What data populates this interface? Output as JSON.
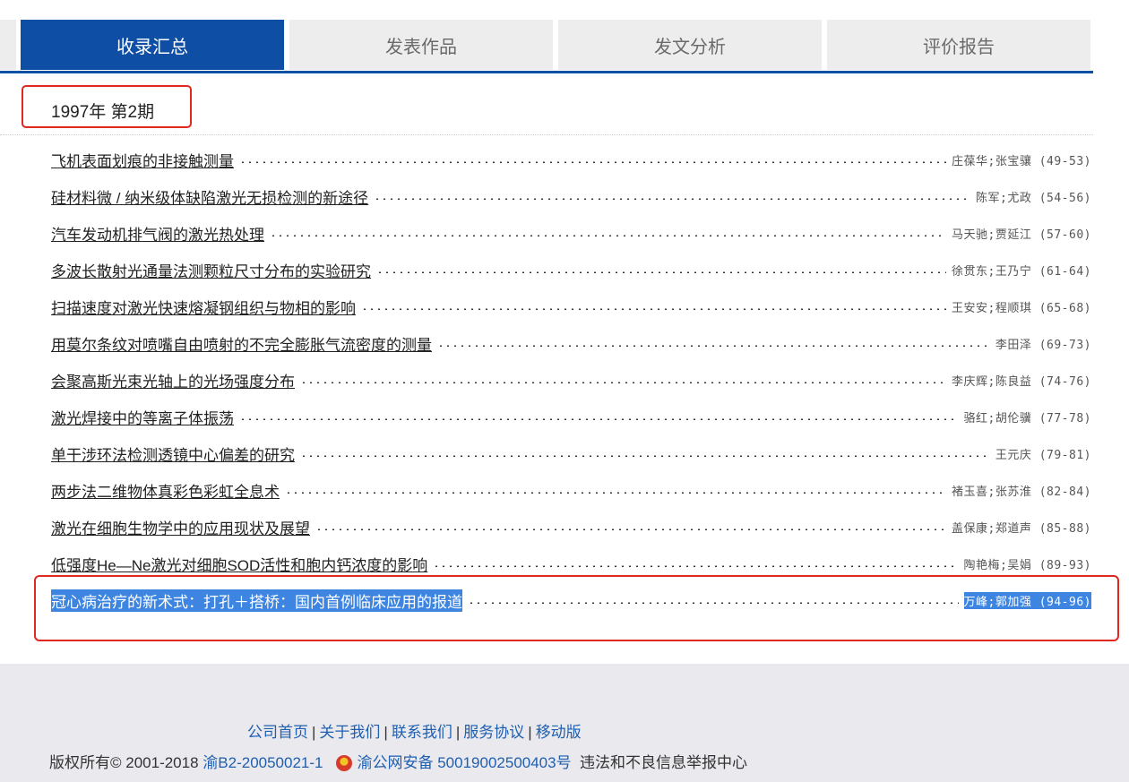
{
  "tabs": [
    {
      "label": "收录汇总",
      "active": true
    },
    {
      "label": "发表作品",
      "active": false
    },
    {
      "label": "发文分析",
      "active": false
    },
    {
      "label": "评价报告",
      "active": false
    }
  ],
  "issue": {
    "label": "1997年 第2期"
  },
  "articles": [
    {
      "title": "飞机表面划痕的非接触测量",
      "authors": "庄葆华;张宝骧",
      "pages": "(49-53)"
    },
    {
      "title": "硅材料微 / 纳米级体缺陷激光无损检测的新途径",
      "authors": "陈军;尤政",
      "pages": "(54-56)"
    },
    {
      "title": "汽车发动机排气阀的激光热处理",
      "authors": "马天驰;贾延江",
      "pages": "(57-60)"
    },
    {
      "title": "多波长散射光通量法测颗粒尺寸分布的实验研究",
      "authors": "徐贯东;王乃宁",
      "pages": "(61-64)"
    },
    {
      "title": "扫描速度对激光快速熔凝钢组织与物相的影响",
      "authors": "王安安;程顺琪",
      "pages": "(65-68)"
    },
    {
      "title": "用莫尔条纹对喷嘴自由喷射的不完全膨胀气流密度的测量",
      "authors": "李田泽",
      "pages": "(69-73)"
    },
    {
      "title": "会聚高斯光束光轴上的光场强度分布",
      "authors": "李庆辉;陈良益",
      "pages": "(74-76)"
    },
    {
      "title": "激光焊接中的等离子体振荡",
      "authors": "骆红;胡伦骥",
      "pages": "(77-78)"
    },
    {
      "title": "单干涉环法检测透镜中心偏差的研究",
      "authors": "王元庆",
      "pages": "(79-81)"
    },
    {
      "title": "两步法二维物体真彩色彩虹全息术",
      "authors": "褚玉喜;张苏淮",
      "pages": "(82-84)"
    },
    {
      "title": "激光在细胞生物学中的应用现状及展望",
      "authors": "盖保康;郑道声",
      "pages": "(85-88)"
    },
    {
      "title": "低强度He—Ne激光对细胞SOD活性和胞内钙浓度的影响",
      "authors": "陶艳梅;吴娟",
      "pages": "(89-93)"
    },
    {
      "title": "冠心病治疗的新术式：打孔＋搭桥：国内首例临床应用的报道",
      "authors": "万峰;郭加强",
      "pages": "(94-96)",
      "selected": true
    }
  ],
  "footer": {
    "links": [
      "公司首页",
      "关于我们",
      "联系我们",
      "服务协议",
      "移动版"
    ],
    "copyright": "版权所有© 2001-2018",
    "icp": "渝B2-20050021-1",
    "police_record": "渝公网安备 50019002500403号",
    "report_center": "违法和不良信息举报中心",
    "icon": "police-badge-icon"
  },
  "colors": {
    "accent": "#0f4ea5",
    "selection": "#3d85e0",
    "highlight_box": "#e0281e"
  }
}
